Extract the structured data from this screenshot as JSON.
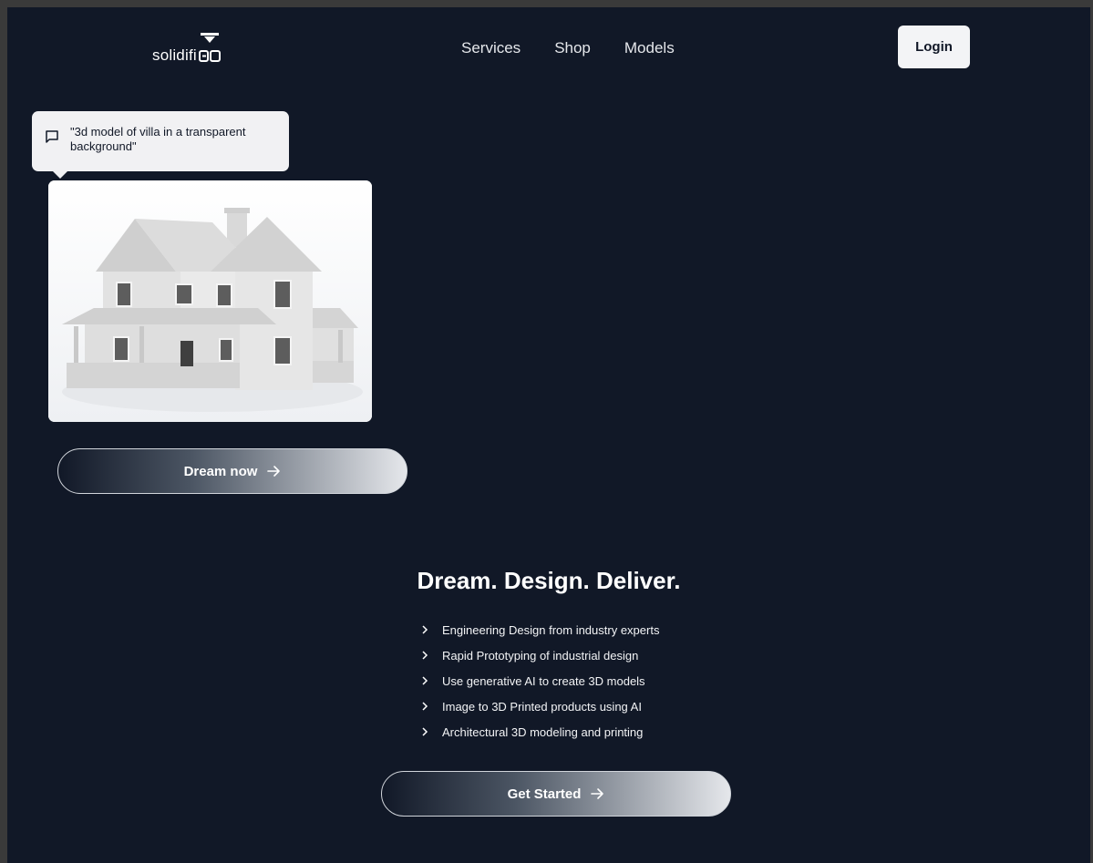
{
  "nav": {
    "logo_text": "solidifi",
    "links": [
      "Services",
      "Shop",
      "Models"
    ],
    "login_label": "Login"
  },
  "prompt_bubble": {
    "text": "\"3d model of villa in a transparent background\""
  },
  "hero": {
    "dream_button_label": "Dream now"
  },
  "section": {
    "headline": "Dream. Design. Deliver.",
    "features": [
      "Engineering Design from industry experts",
      "Rapid Prototyping of industrial design",
      "Use generative AI to create 3D models",
      "Image to 3D Printed products using AI",
      "Architectural 3D modeling and printing"
    ],
    "cta_label": "Get Started"
  },
  "colors": {
    "page_bg": "#111827",
    "button_gradient_end": "#e5e7eb",
    "bubble_bg": "#f1f1f3"
  },
  "icons": {
    "logo": "3d-printer-logo-icon",
    "bubble": "chat-icon",
    "button": "arrow-right-icon",
    "list": "chevron-right-icon"
  }
}
